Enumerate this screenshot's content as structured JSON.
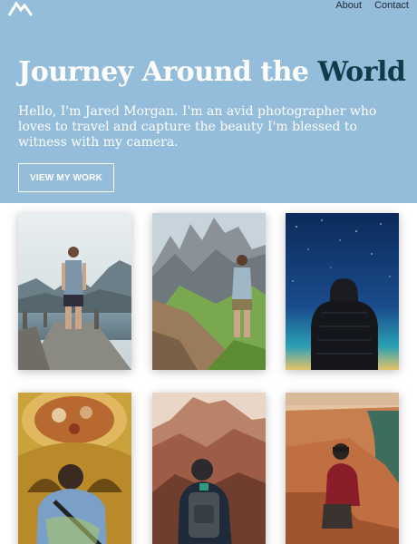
{
  "header": {
    "logo_icon": "mountain-logo-icon",
    "nav": [
      {
        "label": "About"
      },
      {
        "label": "Contact"
      }
    ]
  },
  "hero": {
    "title_main": "Journey Around the ",
    "title_accent": "World",
    "subtitle": "Hello, I'm Jared Morgan. I'm an avid photographer who loves to travel and capture the beauty I'm blessed to witness with my camera.",
    "cta_label": "VIEW MY WORK",
    "background_color": "#94bcdb",
    "accent_color": "#123b4a"
  },
  "gallery": {
    "photos": [
      {
        "subject": "man-on-rocky-pier-lake-mountains"
      },
      {
        "subject": "man-on-green-mountain-ridge"
      },
      {
        "subject": "hooded-man-under-night-sky-aurora"
      },
      {
        "subject": "man-under-ornate-gilded-ceiling"
      },
      {
        "subject": "man-with-backpack-facing-red-canyon"
      },
      {
        "subject": "man-sitting-on-canyon-cliff-river"
      }
    ]
  }
}
